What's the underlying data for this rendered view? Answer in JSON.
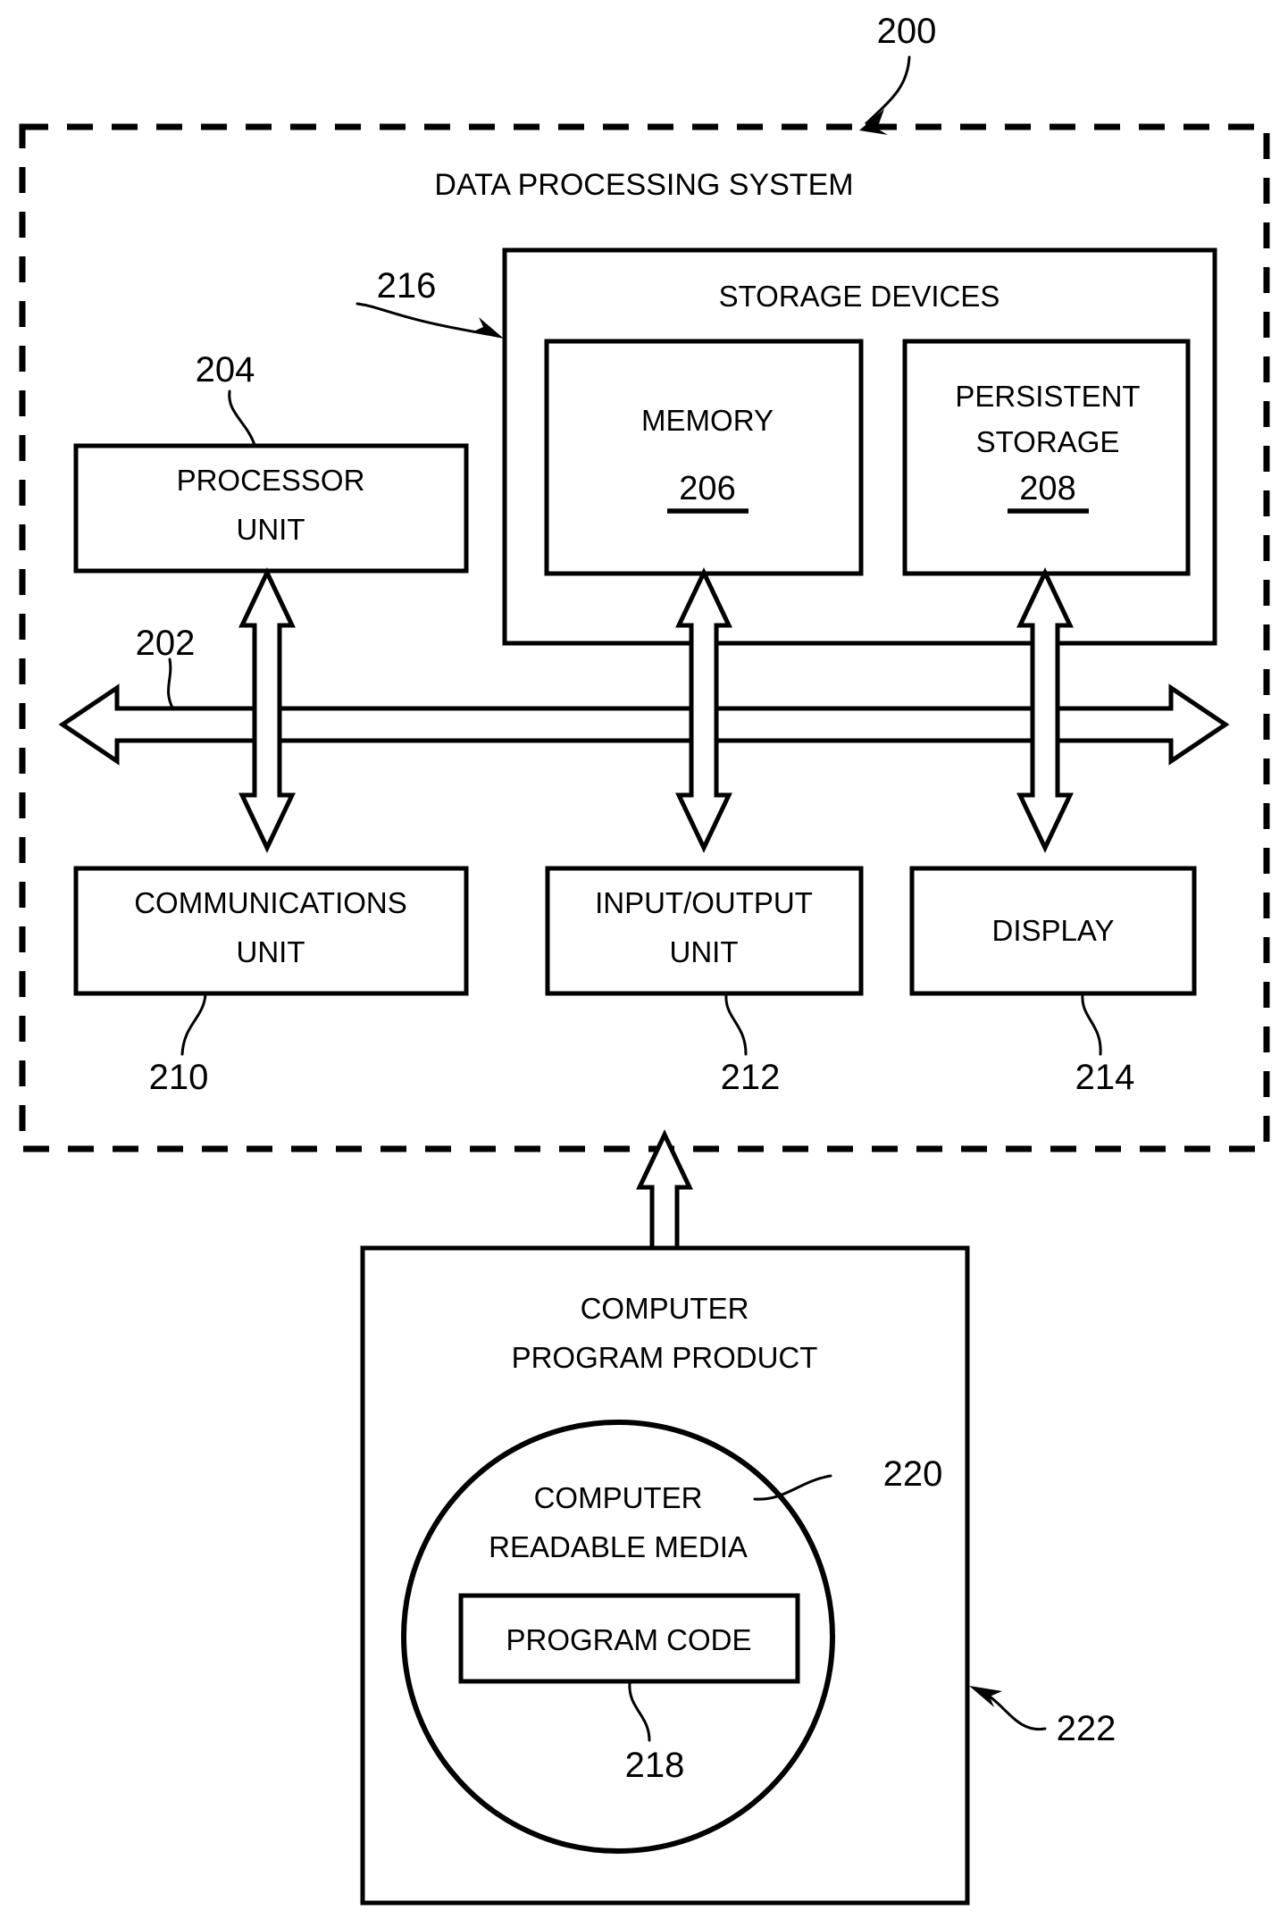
{
  "figure": {
    "type": "patent-block-diagram",
    "figure_reference": "200",
    "system_title": "DATA PROCESSING SYSTEM"
  },
  "reference_numerals": {
    "system": "200",
    "bus": "202",
    "processor_unit": "204",
    "memory": "206",
    "persistent_storage": "208",
    "communications_unit": "210",
    "input_output_unit": "212",
    "display": "214",
    "storage_devices": "216",
    "program_code": "218",
    "computer_readable_media": "220",
    "computer_program_product": "222"
  },
  "blocks": {
    "processor_unit": {
      "line1": "PROCESSOR",
      "line2": "UNIT"
    },
    "storage_devices": {
      "title": "STORAGE DEVICES"
    },
    "memory": {
      "line1": "MEMORY",
      "ref": "206"
    },
    "persistent_storage": {
      "line1": "PERSISTENT",
      "line2": "STORAGE",
      "ref": "208"
    },
    "communications_unit": {
      "line1": "COMMUNICATIONS",
      "line2": "UNIT"
    },
    "input_output_unit": {
      "line1": "INPUT/OUTPUT",
      "line2": "UNIT"
    },
    "display": {
      "line1": "DISPLAY"
    },
    "computer_program_product": {
      "line1": "COMPUTER",
      "line2": "PROGRAM PRODUCT"
    },
    "computer_readable_media": {
      "line1": "COMPUTER",
      "line2": "READABLE MEDIA"
    },
    "program_code": {
      "line1": "PROGRAM CODE"
    }
  },
  "colors": {
    "ink": "#000000",
    "paper": "#ffffff"
  }
}
